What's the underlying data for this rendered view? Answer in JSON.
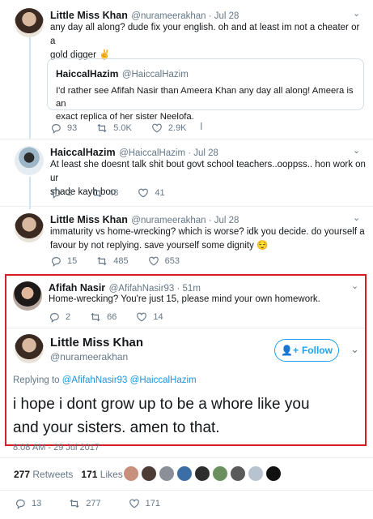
{
  "tweets": [
    {
      "name": "Little Miss Khan",
      "handle": "@nurameerakhan · Jul 28",
      "text_lines": [
        "any day all along? dude fix your english. oh and at least im not a cheater or a",
        "gold digger ✌"
      ],
      "quote": {
        "name": "HaiccalHazim",
        "handle": "@HaiccalHazim",
        "text_lines": [
          "I'd rather see Afifah Nasir than Ameera Khan any day all along! Ameera is an",
          "exact replica of her sister Neelofa."
        ]
      },
      "replies": "93",
      "retweets": "5.0K",
      "likes": "2.9K"
    },
    {
      "name": "HaiccalHazim",
      "handle": "@HaiccalHazim · Jul 28",
      "text_lines": [
        "At least she doesnt talk shit bout govt school teachers..ooppss.. hon work on ur",
        "shade kayh boo"
      ],
      "replies": "2",
      "retweets": "48",
      "likes": "41"
    },
    {
      "name": "Little Miss Khan",
      "handle": "@nurameerakhan · Jul 28",
      "text_lines": [
        "immaturity vs home-wrecking? which is worse? idk you decide. do yourself a",
        "favour by not replying. save yourself some dignity 😌"
      ],
      "replies": "15",
      "retweets": "485",
      "likes": "653"
    },
    {
      "name": "Afifah Nasir",
      "handle": "@AfifahNasir93 · 51m",
      "text_lines": [
        "Home-wrecking? You're just 15, please mind your own homework."
      ],
      "replies": "2",
      "retweets": "66",
      "likes": "14"
    }
  ],
  "main_tweet": {
    "name": "Little Miss Khan",
    "handle": "@nurameerakhan",
    "follow_label": "Follow",
    "replying_to_label": "Replying to",
    "replying_to_handles": "@AfifahNasir93 @HaiccalHazim",
    "text_lines": [
      "i hope i dont grow up to be a whore like you",
      "and your sisters. amen to that."
    ],
    "timestamp": "8:08 AM - 29 Jul 2017",
    "retweets_count": "277",
    "retweets_label": "Retweets",
    "likes_count": "171",
    "likes_label": "Likes",
    "replies": "13",
    "retweets": "277",
    "likes": "171"
  },
  "colors": {
    "accent": "#1da1f2",
    "highlight_border": "#d21e24",
    "muted": "#657786"
  }
}
